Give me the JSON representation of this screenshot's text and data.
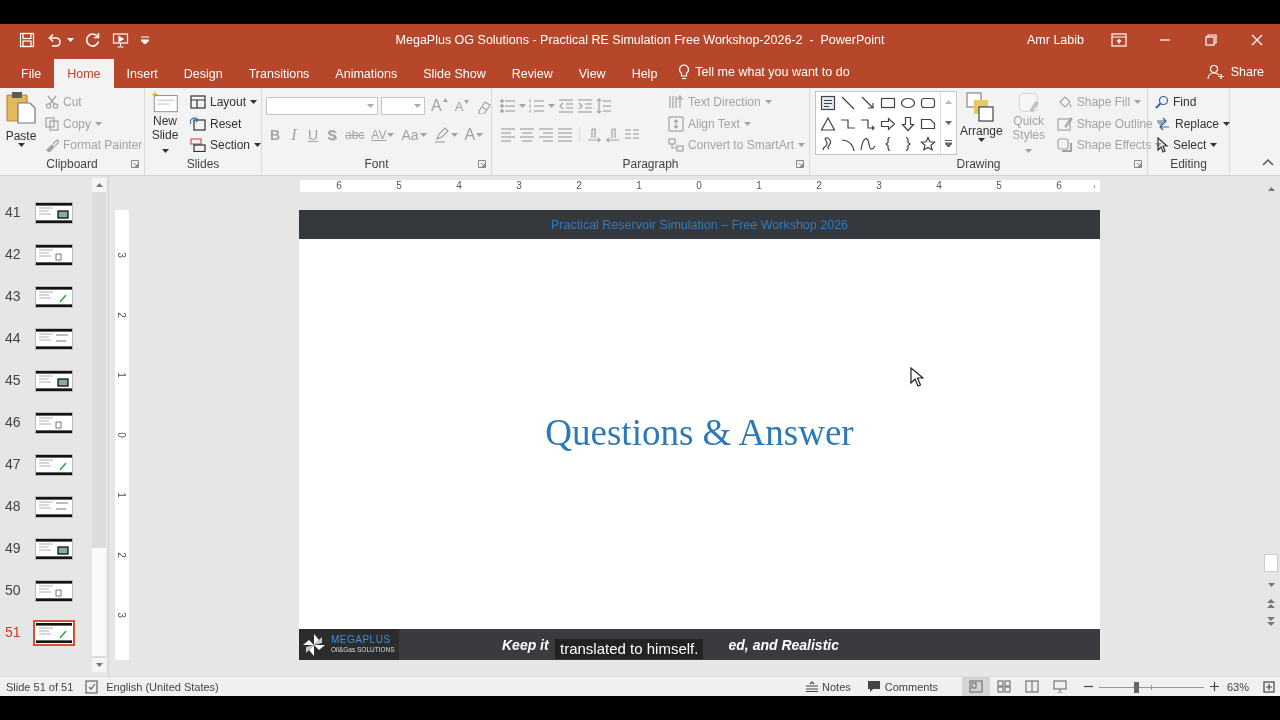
{
  "window": {
    "title": "MegaPlus OG Solutions - Practical RE Simulation Free Workshop-2026-2  -  PowerPoint",
    "user": "Amr Labib"
  },
  "tabs": [
    {
      "label": "File",
      "selected": false
    },
    {
      "label": "Home",
      "selected": true
    },
    {
      "label": "Insert",
      "selected": false
    },
    {
      "label": "Design",
      "selected": false
    },
    {
      "label": "Transitions",
      "selected": false
    },
    {
      "label": "Animations",
      "selected": false
    },
    {
      "label": "Slide Show",
      "selected": false
    },
    {
      "label": "Review",
      "selected": false
    },
    {
      "label": "View",
      "selected": false
    },
    {
      "label": "Help",
      "selected": false
    }
  ],
  "tell_me": "Tell me what you want to do",
  "share": "Share",
  "ribbon": {
    "groups": [
      {
        "kind": "clipboard",
        "label": "Clipboard",
        "launcher": true,
        "commands": [
          {
            "label": "Paste",
            "disabled": false,
            "menu": true
          },
          {
            "label": "Cut",
            "disabled": true,
            "menu": false
          },
          {
            "label": "Copy",
            "disabled": true,
            "menu": true
          },
          {
            "label": "Format Painter",
            "disabled": true,
            "menu": false
          }
        ]
      },
      {
        "kind": "slides",
        "label": "Slides",
        "launcher": false,
        "commands": [
          {
            "label": "New Slide",
            "disabled": false,
            "menu": true
          },
          {
            "label": "Layout",
            "disabled": false,
            "menu": true
          },
          {
            "label": "Reset",
            "disabled": false,
            "menu": false
          },
          {
            "label": "Section",
            "disabled": false,
            "menu": true
          }
        ]
      },
      {
        "kind": "font",
        "label": "Font",
        "launcher": true,
        "buttons": [
          {
            "kind": "grow",
            "label": "A",
            "disabled": true
          },
          {
            "kind": "shrink",
            "label": "A",
            "disabled": true
          },
          {
            "kind": "clear",
            "disabled": true
          },
          {
            "kind": "bold",
            "label": "B",
            "disabled": true
          },
          {
            "kind": "italic",
            "label": "I",
            "disabled": true
          },
          {
            "kind": "underline",
            "label": "U",
            "disabled": true
          },
          {
            "kind": "shadow",
            "label": "S",
            "disabled": true
          },
          {
            "kind": "strike",
            "label": "abc",
            "disabled": true
          },
          {
            "kind": "spacing",
            "label": "AV",
            "disabled": true
          },
          {
            "kind": "case",
            "label": "Aa",
            "disabled": true
          },
          {
            "kind": "highlight",
            "disabled": true
          },
          {
            "kind": "color",
            "label": "A",
            "disabled": true
          }
        ]
      },
      {
        "kind": "paragraph",
        "label": "Paragraph",
        "launcher": true,
        "commands": [
          {
            "label": "Text Direction",
            "disabled": true,
            "menu": true
          },
          {
            "label": "Align Text",
            "disabled": true,
            "menu": true
          },
          {
            "label": "Convert to SmartArt",
            "disabled": true,
            "menu": true
          }
        ]
      },
      {
        "kind": "drawing",
        "label": "Drawing",
        "launcher": true,
        "commands": [
          {
            "label": "Arrange",
            "disabled": false,
            "menu": true
          },
          {
            "label": "Quick Styles",
            "disabled": true,
            "menu": true
          },
          {
            "label": "Shape Fill",
            "disabled": true,
            "menu": true
          },
          {
            "label": "Shape Outline",
            "disabled": true,
            "menu": true
          },
          {
            "label": "Shape Effects",
            "disabled": true,
            "menu": true
          }
        ]
      },
      {
        "kind": "editing",
        "label": "Editing",
        "launcher": false,
        "commands": [
          {
            "label": "Find",
            "disabled": false,
            "menu": false
          },
          {
            "label": "Replace",
            "disabled": false,
            "menu": true
          },
          {
            "label": "Select",
            "disabled": false,
            "menu": true
          }
        ]
      }
    ]
  },
  "slide_pane": {
    "thumbnails": [
      {
        "number": "41",
        "selected": false
      },
      {
        "number": "42",
        "selected": false
      },
      {
        "number": "43",
        "selected": false
      },
      {
        "number": "44",
        "selected": false
      },
      {
        "number": "45",
        "selected": false
      },
      {
        "number": "46",
        "selected": false
      },
      {
        "number": "47",
        "selected": false
      },
      {
        "number": "48",
        "selected": false
      },
      {
        "number": "49",
        "selected": false
      },
      {
        "number": "50",
        "selected": false
      },
      {
        "number": "51",
        "selected": true
      }
    ]
  },
  "horizontal_ruler": [
    "6",
    "5",
    "4",
    "3",
    "2",
    "1",
    "0",
    "1",
    "2",
    "3",
    "4",
    "5",
    "6"
  ],
  "vertical_ruler": [
    "3",
    "2",
    "1",
    "0",
    "1",
    "2",
    "3"
  ],
  "slide": {
    "header": "Practical Reservoir Simulation – Free Workshop 2026",
    "title": "Questions & Answer",
    "logo_name": "MEGAPLUS",
    "logo_tagline": "Oil&Gas SOLUTIONS",
    "footer_start": "Keep it",
    "footer_end": "ed, and Realistic"
  },
  "caption": "translated to himself.",
  "status_bar": {
    "slide_counter": "Slide 51 of 51",
    "language": "English (United States)",
    "notes": "Notes",
    "comments": "Comments",
    "views": [
      {
        "selected": true
      },
      {
        "selected": false
      },
      {
        "selected": false
      },
      {
        "selected": false
      }
    ],
    "zoom": {
      "level": 0.35,
      "reading": "63%"
    }
  }
}
